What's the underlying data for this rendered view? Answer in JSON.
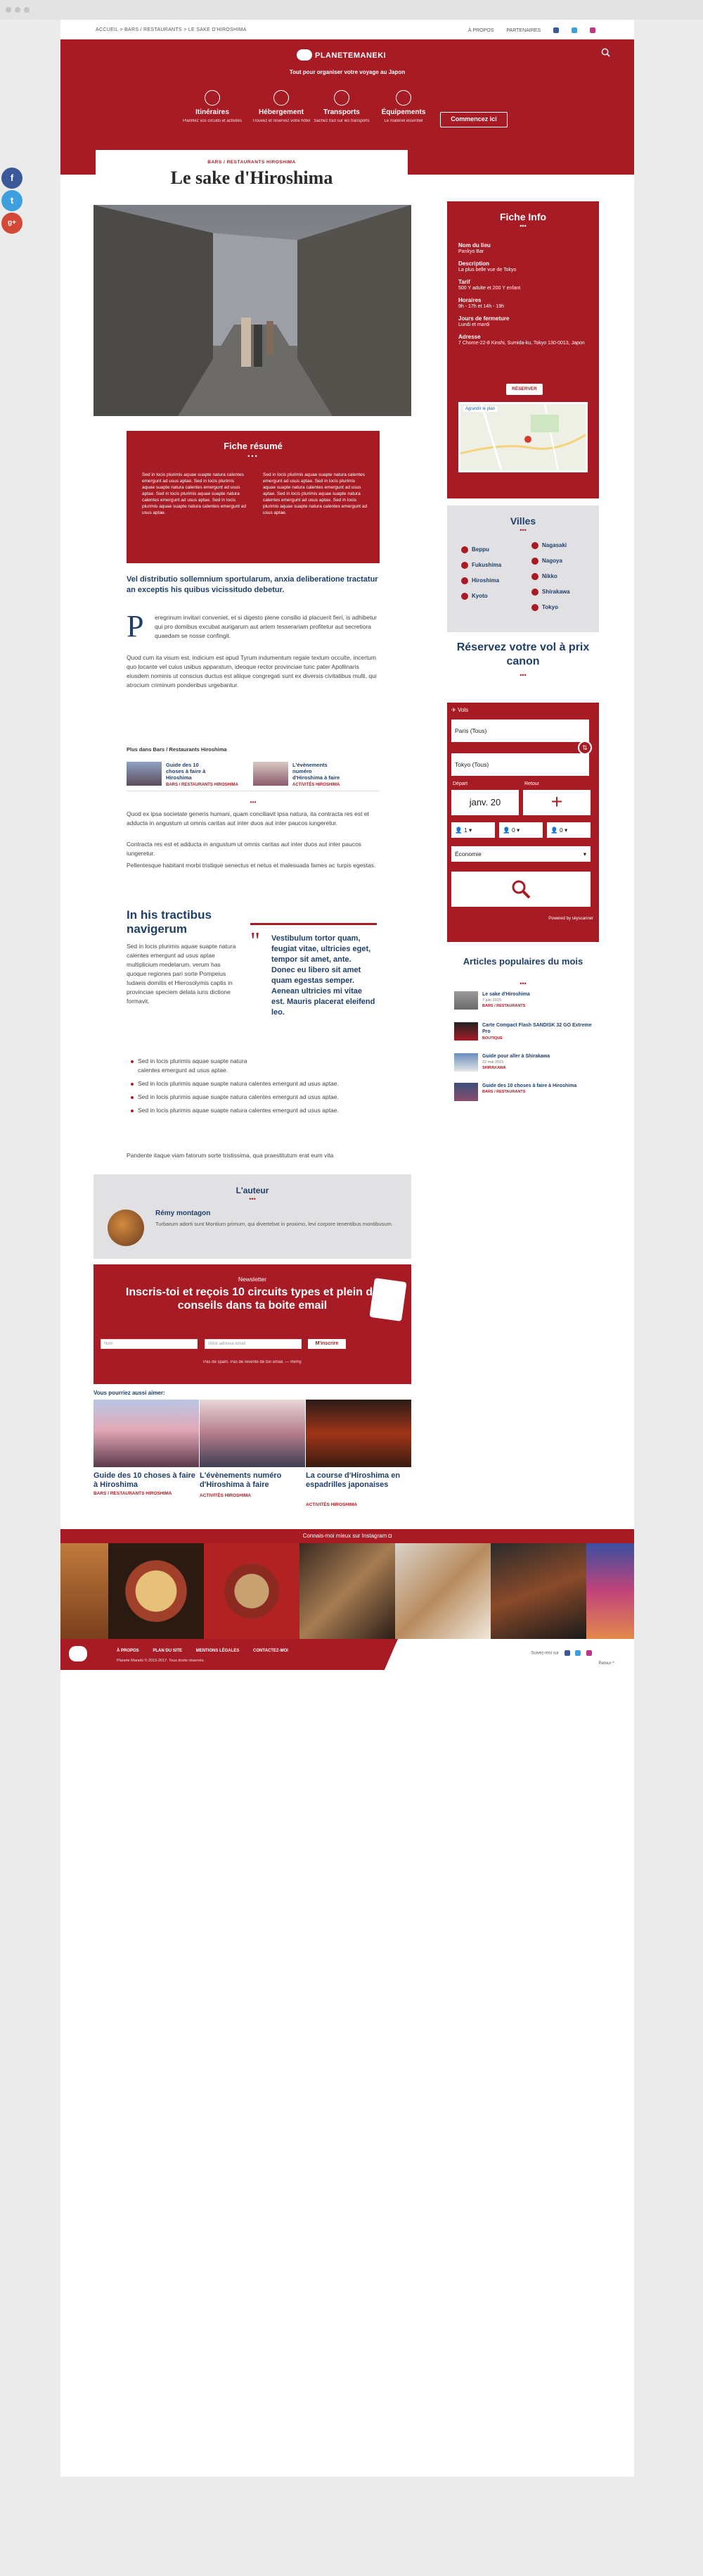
{
  "colors": {
    "primary_red": "#a71b25",
    "navy": "#1f3f6a",
    "panel_grey": "#e1e1e3"
  },
  "breadcrumb": "ACCUEIL > BARS / RESTAURANTS > LE SAKE D'HIROSHIMA",
  "topnav": {
    "about": "À PROPOS",
    "partners": "PARTENAIRES"
  },
  "header": {
    "logo_text": "PLANETEMANEKI",
    "tagline": "Tout pour organiser votre voyage au Japon",
    "cta": "Commencez ici",
    "nav": [
      {
        "title": "Itinéraires",
        "sub": "Planifiez vos circuits et activités",
        "icon": "map-icon"
      },
      {
        "title": "Hébergement",
        "sub": "Trouvez et réservez votre hôtel",
        "icon": "bed-icon"
      },
      {
        "title": "Transports",
        "sub": "Sachez tout sur les transports",
        "icon": "train-icon"
      },
      {
        "title": "Équipements",
        "sub": "Le matériel essentiel",
        "icon": "bag-icon"
      }
    ]
  },
  "article": {
    "category": "BARS / RESTAURANTS HIROSHIMA",
    "title": "Le sake d'Hiroshima",
    "fiche_resume": {
      "title": "Fiche résumé",
      "col1": "Sed in locis plurimis aquae suapte natura calentes emergunt ad usus aptae. Sed in locis plurimis aquae suapte natura calentes emergunt ad usus aptae. Sed in locis plurimis aquae suapte natura calentes emergunt ad usus aptae. Sed in locis plurimis aquae suapte natura calentes emergunt ad usus aptae.",
      "col2": "Sed in locis plurimis aquae suapte natura calentes emergunt ad usus aptae. Sed in locis plurimis aquae suapte natura calentes emergunt ad usus aptae. Sed in locis plurimis aquae suapte natura calentes emergunt ad usus aptae. Sed in locis plurimis aquae suapte natura calentes emergunt ad usus aptae."
    },
    "lead": "Vel distributio sollemnium sportularum, anxia deliberatione tractatur an exceptis his quibus vicissitudo debetur.",
    "dropcap": "P",
    "para1": "eregrinum invitari conveniet, et si digesto plene consilio id placuerit fieri, is adhibetur qui pro domibus excubat aurigarum aut artem tesserariam profitetur aut secretiora quaedam se nosse confingit.",
    "para2": "Quod cum ita visum est, indicium est apud Tyrum indumentum regale textum occulte, incertum quo locante vel cuius usibus apparatum, ideoque rector provinciae tunc pater Apollinaris eiusdem nominis ut conscius ductus est aliique congregati sunt ex diversis civitatibus multi, qui atrocium criminum ponderibus urgebantur.",
    "related_heading": "Plus dans Bars / Restaurants Hiroshima",
    "related": [
      {
        "title": "Guide des 10 choses à faire à Hiroshima",
        "cat": "BARS / RESTAURANTS HIROSHIMA"
      },
      {
        "title": "L'évènements numéro d'Hiroshima à faire",
        "cat": "ACTIVITÉS HIROSHIMA"
      }
    ],
    "para3": "Quod ex ipsa societate generis humani, quam conciliavit ipsa natura, ita contracta res est et adducta in angustum ut omnis caritas aut inter duos aut inter paucos iungeretur.",
    "para4": "Contracta res est et adducta in angustum ut omnis caritas aut inter duos aut inter paucos iungeretur.",
    "para5": "Pellentesque habitant morbi tristique senectus et netus et malesuada fames ac turpis egestas.",
    "h2": "In his tractibus navigerum",
    "para6": "Sed in locis plurimis aquae suapte natura calentes emergunt ad usus aptae multiplicium medelarum. verum has quoque regiones pari sorte Pompeius Iudaeis domitis et Hierosolymis captis in provinciae speciem delata iuris dictione formavit.",
    "quote": "Vestibulum tortor quam, feugiat vitae, ultricies eget, tempor sit amet, ante. Donec eu libero sit amet quam egestas semper. Aenean ultricies mi vitae est. Mauris placerat eleifend leo.",
    "bullets": [
      "Sed in locis plurimis aquae suapte natura calentes emergunt ad usus aptae.",
      "Sed in locis plurimis aquae suapte natura calentes emergunt ad usus aptae.",
      "Sed in locis plurimis aquae suapte natura calentes emergunt ad usus aptae.",
      "Sed in locis plurimis aquae suapte natura calentes emergunt ad usus aptae."
    ],
    "para7": "Pandente itaque viam fatorum sorte tristissima, qua praestitutum erat eum vita"
  },
  "author": {
    "heading": "L'auteur",
    "name": "Rémy montagon",
    "bio": "Turbarum adorti sunt Montium primum, qui divertebat in proximo, levi corpore tenentibus montibusum."
  },
  "newsletter": {
    "label": "Newsletter",
    "headline": "Inscris-toi et reçois 10 circuits types et plein de conseils dans ta boite email",
    "name_placeholder": "Nom",
    "email_placeholder": "Votre adresse email",
    "button": "M'inscrire",
    "note": "Pas de spam. Pas de revente de ton email. — Rémy"
  },
  "suggestions": {
    "heading": "Vous pourriez aussi aimer:",
    "items": [
      {
        "title": "Guide des 10 choses à faire à Hiroshima",
        "cat": "BARS / RESTAURANTS HIROSHIMA"
      },
      {
        "title": "L'évènements numéro d'Hiroshima à faire",
        "cat": "ACTIVITÉS HIROSHIMA"
      },
      {
        "title": "La course d'Hiroshima en espadrilles japonaises",
        "cat": "ACTIVITÉS HIROSHIMA"
      }
    ]
  },
  "fiche_info": {
    "title": "Fiche Info",
    "rows": [
      {
        "label": "Nom du lieu",
        "value": "Pankyo Bar"
      },
      {
        "label": "Description",
        "value": "La plus belle vue de Tokyo"
      },
      {
        "label": "Tarif",
        "value": "500 Y adulte et 200 Y enfant"
      },
      {
        "label": "Horaires",
        "value": "9h - 17h et 14h - 19h"
      },
      {
        "label": "Jours de fermeture",
        "value": "Lundi et mardi"
      },
      {
        "label": "Adresse",
        "value": "7 Chome-22-8 Kinshi, Sumida-ku, Tokyo 130-0013, Japon"
      }
    ],
    "reserve": "RÉSERVER",
    "map_label": "Agrandir le plan"
  },
  "villes": {
    "title": "Villes",
    "items": [
      "Beppu",
      "Nagasaki",
      "Fukushima",
      "Nagoya",
      "Hiroshima",
      "Nikko",
      "Kyoto",
      "Shirakawa",
      "Tokyo"
    ]
  },
  "reserve_vol": {
    "title": "Réservez votre vol à prix canon"
  },
  "flight": {
    "tab": "Vols",
    "from": "Paris (Tous)",
    "to": "Tokyo (Tous)",
    "depart_label": "Départ",
    "depart_value": "janv. 20",
    "retour_label": "Retour",
    "adults": "1",
    "children": "0",
    "infants": "0",
    "cabin": "Économie",
    "powered": "Powered by skyscanner"
  },
  "articles_populaires": {
    "title": "Articles populaires du mois",
    "items": [
      {
        "title": "Le sake d'Hiroshima",
        "meta": "7 juin 2015",
        "cat": "BARS / RESTAURANTS"
      },
      {
        "title": "Carte Compact Flash SANDISK 32 GO Extreme Pro",
        "meta": "",
        "cat": "BOUTIQUE"
      },
      {
        "title": "Guide pour aller à Shirakawa",
        "meta": "22 mai 2015",
        "cat": "SHIRAKAWA"
      },
      {
        "title": "Guide des 10 choses à faire à Hiroshima",
        "meta": "",
        "cat": "BARS / RESTAURANTS"
      }
    ]
  },
  "instagram": {
    "label": "Connais-moi mieux sur Instagram"
  },
  "footer": {
    "links": [
      "À PROPOS",
      "PLAN DU SITE",
      "MENTIONS LÉGALES",
      "CONTACTEZ-MOI"
    ],
    "copyright": "Planete Maneki © 2015-2017. Tous droits réservés.",
    "follow": "Suivez-moi sur",
    "back_top": "Retour ^"
  },
  "share": [
    "f",
    "t",
    "g+"
  ]
}
